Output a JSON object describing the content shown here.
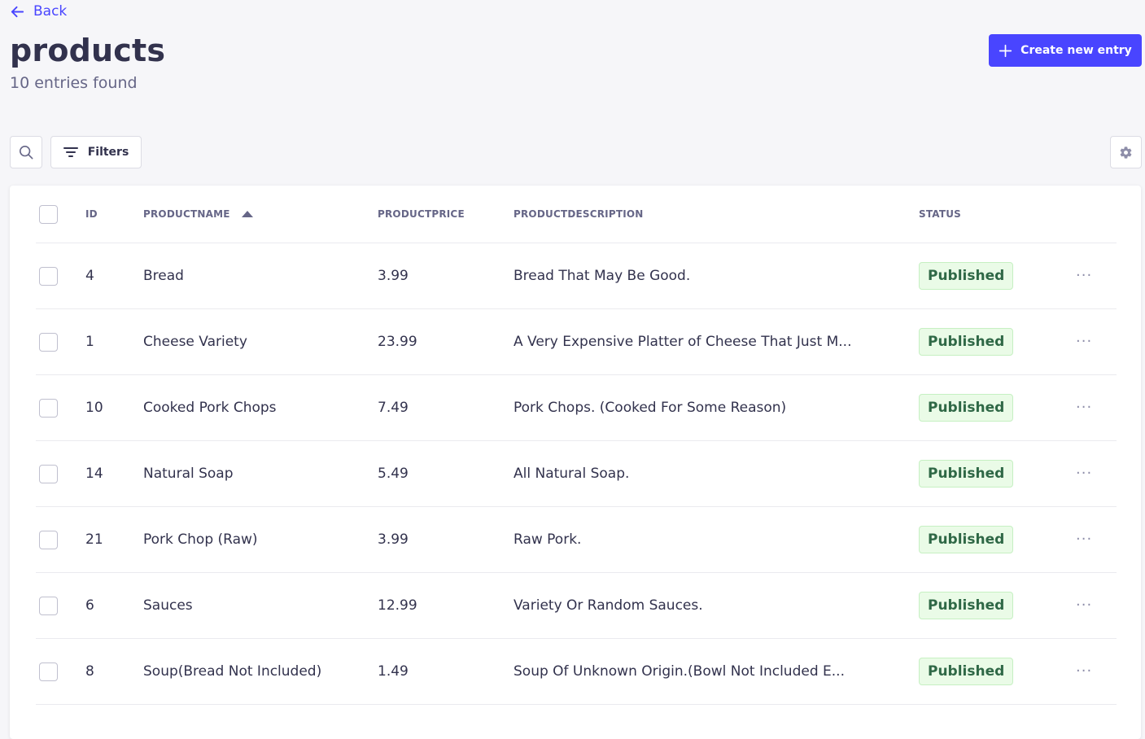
{
  "header": {
    "back_label": "Back",
    "title": "products",
    "subtitle": "10 entries found",
    "create_label": "Create new entry"
  },
  "toolbar": {
    "filters_label": "Filters"
  },
  "table": {
    "columns": {
      "id": "ID",
      "name": "PRODUCTNAME",
      "price": "PRODUCTPRICE",
      "description": "PRODUCTDESCRIPTION",
      "status": "STATUS"
    },
    "sort": {
      "column": "PRODUCTNAME",
      "direction": "ascending"
    },
    "rows": [
      {
        "id": "4",
        "name": "Bread",
        "price": "3.99",
        "description": "Bread That May Be Good.",
        "status": "Published"
      },
      {
        "id": "1",
        "name": "Cheese Variety",
        "price": "23.99",
        "description": "A Very Expensive Platter of Cheese That Just M...",
        "status": "Published"
      },
      {
        "id": "10",
        "name": "Cooked Pork Chops",
        "price": "7.49",
        "description": "Pork Chops. (Cooked For Some Reason)",
        "status": "Published"
      },
      {
        "id": "14",
        "name": "Natural Soap",
        "price": "5.49",
        "description": "All Natural Soap.",
        "status": "Published"
      },
      {
        "id": "21",
        "name": "Pork Chop (Raw)",
        "price": "3.99",
        "description": "Raw Pork.",
        "status": "Published"
      },
      {
        "id": "6",
        "name": "Sauces",
        "price": "12.99",
        "description": "Variety Or Random Sauces.",
        "status": "Published"
      },
      {
        "id": "8",
        "name": "Soup(Bread Not Included)",
        "price": "1.49",
        "description": "Soup Of Unknown Origin.(Bowl Not Included E...",
        "status": "Published"
      }
    ]
  },
  "icons": {
    "back": "arrow-left-icon",
    "create": "plus-icon",
    "search": "search-icon",
    "filters": "filter-icon",
    "settings": "gear-icon",
    "row_actions": "more-icon"
  },
  "colors": {
    "accent": "#4945ff",
    "background": "#f6f6f9",
    "published_bg": "#eafbe7",
    "published_text": "#2f6846"
  }
}
